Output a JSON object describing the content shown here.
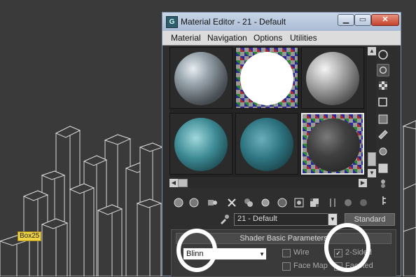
{
  "viewport": {
    "object_label": "Box25"
  },
  "window": {
    "title": "Material Editor - 21 - Default",
    "app_icon": "3ds-icon",
    "minimize_icon": "minimize-icon",
    "maximize_icon": "maximize-icon",
    "close_icon": "close-icon"
  },
  "menu": {
    "items": [
      "Material",
      "Navigation",
      "Options",
      "Utilities"
    ]
  },
  "material": {
    "name": "21 - Default",
    "type": "Standard"
  },
  "shader_rollout": {
    "title": "Shader Basic Parameters",
    "shader": "Blinn",
    "options": [
      {
        "label": "Wire",
        "checked": false
      },
      {
        "label": "2-Sided",
        "checked": true
      },
      {
        "label": "Face Map",
        "checked": false
      },
      {
        "label": "Faceted",
        "checked": false
      }
    ]
  },
  "colors": {
    "viewport_bg": "#3a3a3a",
    "title_bar": "#b8c8dd",
    "active_slot_border": "#e8e8e8"
  }
}
